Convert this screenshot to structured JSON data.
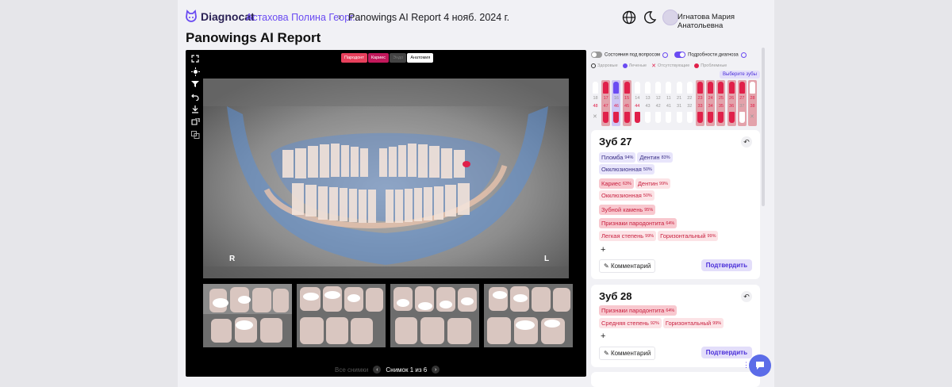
{
  "header": {
    "logo_text": "Diagnocat",
    "breadcrumb_patient": "Астахова Полина Георг...",
    "breadcrumb_separator": "›",
    "breadcrumb_report": "Panowings AI Report 4 нояб. 2024 г.",
    "icons": [
      "globe-icon",
      "moon-icon"
    ],
    "user_name": "Игнатова Мария Анатольевна"
  },
  "page_title": "Panowings AI Report",
  "viewer": {
    "tools": [
      "expand-icon",
      "brightness-icon",
      "filter-icon",
      "undo-icon",
      "download-icon",
      "split-view-icon",
      "compare-icon"
    ],
    "filters": [
      {
        "label": "Пародонт",
        "style": "perio"
      },
      {
        "label": "Кариес",
        "style": "caries"
      },
      {
        "label": "Эндо",
        "style": "endo"
      },
      {
        "label": "Анатомия",
        "style": "anat"
      }
    ],
    "pano_labels": {
      "right": "R",
      "left": "L"
    },
    "pager": {
      "all_label": "Все снимки",
      "text": "Снимок 1 из 6"
    }
  },
  "panel": {
    "toggle_questions": "Состояния под вопросом",
    "toggle_details": "Подробности диагноза",
    "legend": [
      {
        "label": "Здоровые",
        "color": "#ffffff"
      },
      {
        "label": "Леченые",
        "color": "#6a4bf2"
      },
      {
        "label": "Отсутствующие",
        "color": "#e0204a"
      },
      {
        "label": "Проблемные",
        "color": "#e0204a"
      }
    ],
    "select_teeth_label": "Выберите зубы",
    "upper_numbers": [
      "18",
      "17",
      "16",
      "15",
      "14",
      "13",
      "12",
      "11",
      "21",
      "22",
      "23",
      "24",
      "25",
      "26",
      "27",
      "28"
    ],
    "lower_numbers": [
      "48",
      "47",
      "46",
      "45",
      "44",
      "43",
      "42",
      "41",
      "31",
      "32",
      "33",
      "34",
      "35",
      "36",
      "37",
      "38"
    ]
  },
  "cards": [
    {
      "title": "Зуб 27",
      "rows": [
        [
          {
            "label": "Пломба",
            "pct": "94%",
            "tone": "violet"
          },
          {
            "label": "Дентин",
            "pct": "83%",
            "tone": "violet"
          }
        ],
        [
          {
            "label": "Окклюзионная",
            "pct": "50%",
            "tone": "violet"
          }
        ],
        [
          {
            "label": "Кариес",
            "pct": "63%",
            "tone": "red"
          },
          {
            "label": "Дентин",
            "pct": "99%",
            "tone": "red"
          }
        ],
        [
          {
            "label": "Окклюзионная",
            "pct": "50%",
            "tone": "red"
          }
        ],
        [
          {
            "label": "Зубной камень",
            "pct": "95%",
            "tone": "red"
          }
        ],
        [
          {
            "label": "Признаки пародонтита",
            "pct": "64%",
            "tone": "red"
          }
        ],
        [
          {
            "label": "Легкая степень",
            "pct": "99%",
            "tone": "red"
          },
          {
            "label": "Горизонтальный",
            "pct": "99%",
            "tone": "red"
          }
        ]
      ],
      "add": "+",
      "comment": "Комментарий",
      "confirm": "Подтвердить"
    },
    {
      "title": "Зуб 28",
      "rows": [
        [
          {
            "label": "Признаки пародонтита",
            "pct": "64%",
            "tone": "red"
          }
        ],
        [
          {
            "label": "Средняя степень",
            "pct": "92%",
            "tone": "red"
          },
          {
            "label": "Горизонтальный",
            "pct": "99%",
            "tone": "red"
          }
        ]
      ],
      "add": "+",
      "comment": "Комментарий",
      "confirm": "Подтвердить"
    }
  ]
}
